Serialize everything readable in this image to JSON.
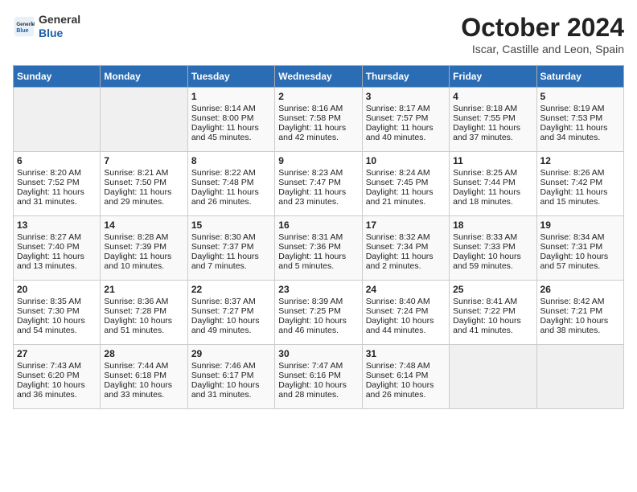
{
  "header": {
    "logo_general": "General",
    "logo_blue": "Blue",
    "month_title": "October 2024",
    "location": "Iscar, Castille and Leon, Spain"
  },
  "weekdays": [
    "Sunday",
    "Monday",
    "Tuesday",
    "Wednesday",
    "Thursday",
    "Friday",
    "Saturday"
  ],
  "weeks": [
    [
      {
        "day": "",
        "info": ""
      },
      {
        "day": "",
        "info": ""
      },
      {
        "day": "1",
        "info": "Sunrise: 8:14 AM\nSunset: 8:00 PM\nDaylight: 11 hours and 45 minutes."
      },
      {
        "day": "2",
        "info": "Sunrise: 8:16 AM\nSunset: 7:58 PM\nDaylight: 11 hours and 42 minutes."
      },
      {
        "day": "3",
        "info": "Sunrise: 8:17 AM\nSunset: 7:57 PM\nDaylight: 11 hours and 40 minutes."
      },
      {
        "day": "4",
        "info": "Sunrise: 8:18 AM\nSunset: 7:55 PM\nDaylight: 11 hours and 37 minutes."
      },
      {
        "day": "5",
        "info": "Sunrise: 8:19 AM\nSunset: 7:53 PM\nDaylight: 11 hours and 34 minutes."
      }
    ],
    [
      {
        "day": "6",
        "info": "Sunrise: 8:20 AM\nSunset: 7:52 PM\nDaylight: 11 hours and 31 minutes."
      },
      {
        "day": "7",
        "info": "Sunrise: 8:21 AM\nSunset: 7:50 PM\nDaylight: 11 hours and 29 minutes."
      },
      {
        "day": "8",
        "info": "Sunrise: 8:22 AM\nSunset: 7:48 PM\nDaylight: 11 hours and 26 minutes."
      },
      {
        "day": "9",
        "info": "Sunrise: 8:23 AM\nSunset: 7:47 PM\nDaylight: 11 hours and 23 minutes."
      },
      {
        "day": "10",
        "info": "Sunrise: 8:24 AM\nSunset: 7:45 PM\nDaylight: 11 hours and 21 minutes."
      },
      {
        "day": "11",
        "info": "Sunrise: 8:25 AM\nSunset: 7:44 PM\nDaylight: 11 hours and 18 minutes."
      },
      {
        "day": "12",
        "info": "Sunrise: 8:26 AM\nSunset: 7:42 PM\nDaylight: 11 hours and 15 minutes."
      }
    ],
    [
      {
        "day": "13",
        "info": "Sunrise: 8:27 AM\nSunset: 7:40 PM\nDaylight: 11 hours and 13 minutes."
      },
      {
        "day": "14",
        "info": "Sunrise: 8:28 AM\nSunset: 7:39 PM\nDaylight: 11 hours and 10 minutes."
      },
      {
        "day": "15",
        "info": "Sunrise: 8:30 AM\nSunset: 7:37 PM\nDaylight: 11 hours and 7 minutes."
      },
      {
        "day": "16",
        "info": "Sunrise: 8:31 AM\nSunset: 7:36 PM\nDaylight: 11 hours and 5 minutes."
      },
      {
        "day": "17",
        "info": "Sunrise: 8:32 AM\nSunset: 7:34 PM\nDaylight: 11 hours and 2 minutes."
      },
      {
        "day": "18",
        "info": "Sunrise: 8:33 AM\nSunset: 7:33 PM\nDaylight: 10 hours and 59 minutes."
      },
      {
        "day": "19",
        "info": "Sunrise: 8:34 AM\nSunset: 7:31 PM\nDaylight: 10 hours and 57 minutes."
      }
    ],
    [
      {
        "day": "20",
        "info": "Sunrise: 8:35 AM\nSunset: 7:30 PM\nDaylight: 10 hours and 54 minutes."
      },
      {
        "day": "21",
        "info": "Sunrise: 8:36 AM\nSunset: 7:28 PM\nDaylight: 10 hours and 51 minutes."
      },
      {
        "day": "22",
        "info": "Sunrise: 8:37 AM\nSunset: 7:27 PM\nDaylight: 10 hours and 49 minutes."
      },
      {
        "day": "23",
        "info": "Sunrise: 8:39 AM\nSunset: 7:25 PM\nDaylight: 10 hours and 46 minutes."
      },
      {
        "day": "24",
        "info": "Sunrise: 8:40 AM\nSunset: 7:24 PM\nDaylight: 10 hours and 44 minutes."
      },
      {
        "day": "25",
        "info": "Sunrise: 8:41 AM\nSunset: 7:22 PM\nDaylight: 10 hours and 41 minutes."
      },
      {
        "day": "26",
        "info": "Sunrise: 8:42 AM\nSunset: 7:21 PM\nDaylight: 10 hours and 38 minutes."
      }
    ],
    [
      {
        "day": "27",
        "info": "Sunrise: 7:43 AM\nSunset: 6:20 PM\nDaylight: 10 hours and 36 minutes."
      },
      {
        "day": "28",
        "info": "Sunrise: 7:44 AM\nSunset: 6:18 PM\nDaylight: 10 hours and 33 minutes."
      },
      {
        "day": "29",
        "info": "Sunrise: 7:46 AM\nSunset: 6:17 PM\nDaylight: 10 hours and 31 minutes."
      },
      {
        "day": "30",
        "info": "Sunrise: 7:47 AM\nSunset: 6:16 PM\nDaylight: 10 hours and 28 minutes."
      },
      {
        "day": "31",
        "info": "Sunrise: 7:48 AM\nSunset: 6:14 PM\nDaylight: 10 hours and 26 minutes."
      },
      {
        "day": "",
        "info": ""
      },
      {
        "day": "",
        "info": ""
      }
    ]
  ]
}
